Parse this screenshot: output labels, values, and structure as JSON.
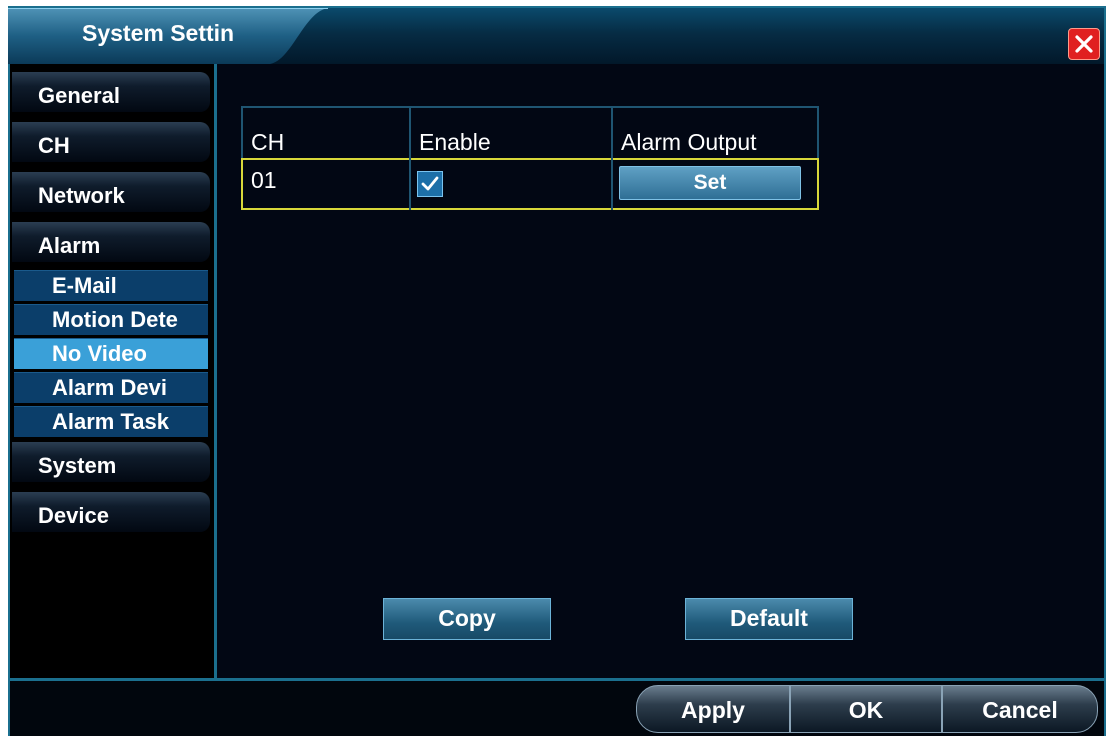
{
  "window": {
    "title": "System Settin"
  },
  "sidebar": {
    "items": [
      {
        "label": "General"
      },
      {
        "label": "CH"
      },
      {
        "label": "Network"
      },
      {
        "label": "Alarm"
      }
    ],
    "alarm_subitems": [
      {
        "label": "E-Mail",
        "active": false
      },
      {
        "label": "Motion Dete",
        "active": false
      },
      {
        "label": "No Video",
        "active": true
      },
      {
        "label": "Alarm Devi",
        "active": false
      },
      {
        "label": "Alarm Task",
        "active": false
      }
    ],
    "items_after": [
      {
        "label": "System"
      },
      {
        "label": "Device"
      }
    ]
  },
  "table": {
    "columns": [
      "CH",
      "Enable",
      "Alarm Output"
    ],
    "rows": [
      {
        "ch": "01",
        "enabled": true,
        "alarm_output_button": "Set"
      }
    ]
  },
  "actions": {
    "copy": "Copy",
    "default": "Default"
  },
  "footer": {
    "apply": "Apply",
    "ok": "OK",
    "cancel": "Cancel"
  },
  "colors": {
    "accent": "#1b6f8e",
    "active_sub": "#3aa0d8",
    "close_red": "#e02020",
    "row_highlight": "#d8d83a"
  }
}
